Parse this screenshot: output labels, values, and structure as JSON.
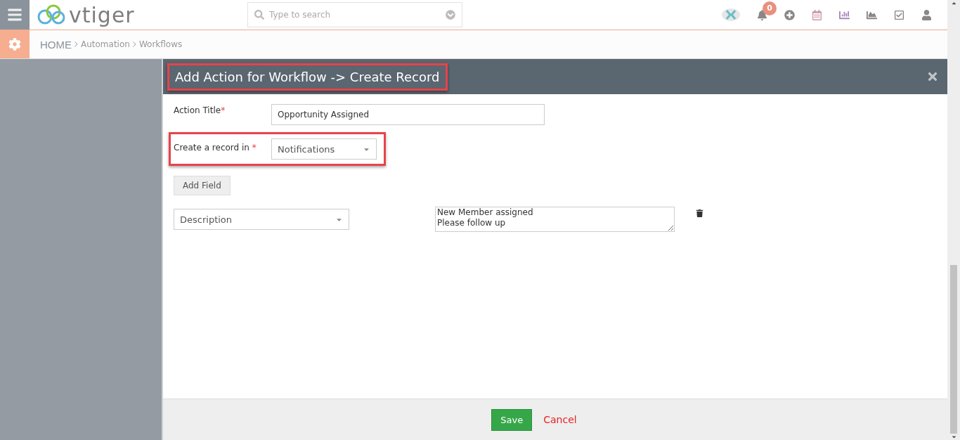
{
  "header": {
    "logo": "vtiger",
    "search": {
      "placeholder": "Type to search"
    },
    "notifications": {
      "count": "0"
    }
  },
  "breadcrumb": [
    "HOME",
    "Automation",
    "Workflows"
  ],
  "dialog": {
    "title": "Add Action for Workflow -> Create Record",
    "title_highlighted": true,
    "action_title": {
      "label": "Action Title",
      "required_mark": "*",
      "value": "Opportunity Assigned"
    },
    "create_in": {
      "label": "Create a record in",
      "required_mark": "*",
      "value": "Notifications",
      "highlighted": true
    },
    "add_field_button": "Add Field",
    "fields": [
      {
        "field": "Description",
        "value": "New Member assigned\nPlease follow up"
      }
    ],
    "buttons": {
      "save": "Save",
      "cancel": "Cancel"
    }
  }
}
